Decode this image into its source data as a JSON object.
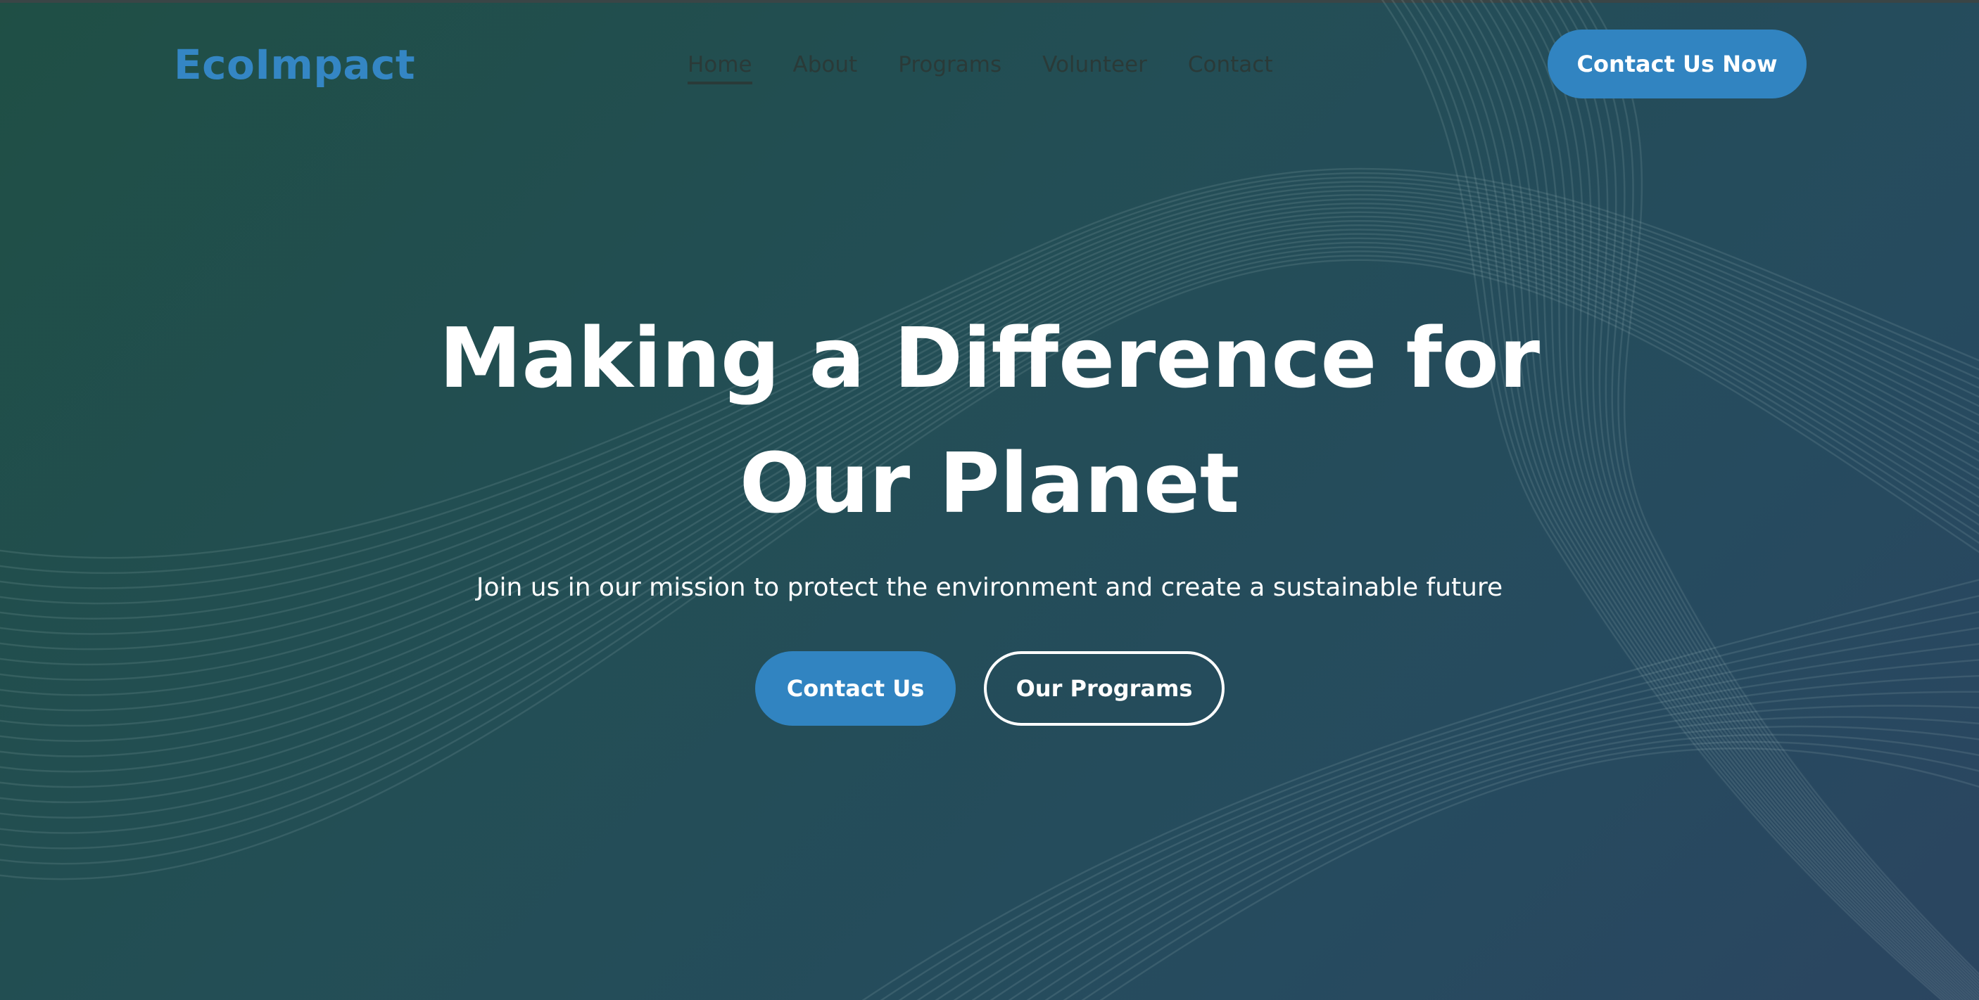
{
  "brand": {
    "name": "EcoImpact",
    "color": "#3486c4"
  },
  "nav": {
    "items": [
      {
        "label": "Home",
        "active": true
      },
      {
        "label": "About",
        "active": false
      },
      {
        "label": "Programs",
        "active": false
      },
      {
        "label": "Volunteer",
        "active": false
      },
      {
        "label": "Contact",
        "active": false
      }
    ],
    "cta_label": "Contact Us Now"
  },
  "hero": {
    "title_line1": "Making a Difference for",
    "title_line2": "Our Planet",
    "subtitle": "Join us in our mission to protect the environment and create a sustainable future",
    "primary_button": "Contact Us",
    "secondary_button": "Our Programs"
  },
  "colors": {
    "accent": "#3184c1",
    "background_start": "#1f4f45",
    "background_end": "#2b4560",
    "text": "#ffffff"
  }
}
